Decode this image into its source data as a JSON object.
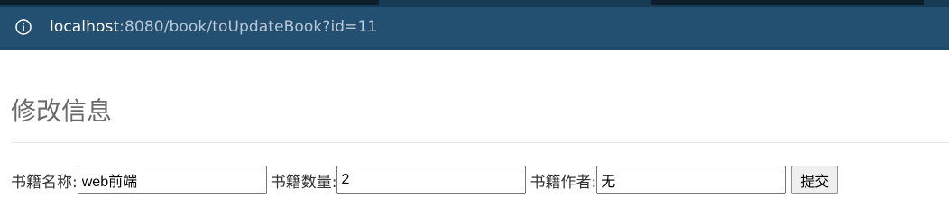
{
  "browser": {
    "url_host": "localhost",
    "url_rest": ":8080/book/toUpdateBook?id=11"
  },
  "page": {
    "title": "修改信息"
  },
  "form": {
    "name_label": "书籍名称:",
    "name_value": "web前端",
    "count_label": "书籍数量:",
    "count_value": "2",
    "author_label": "书籍作者:",
    "author_value": "无",
    "submit_label": "提交"
  },
  "icons": {
    "address_bar": "info-icon"
  },
  "colors": {
    "browser_bar": "#234f71",
    "title_text": "#6b6b6b"
  }
}
